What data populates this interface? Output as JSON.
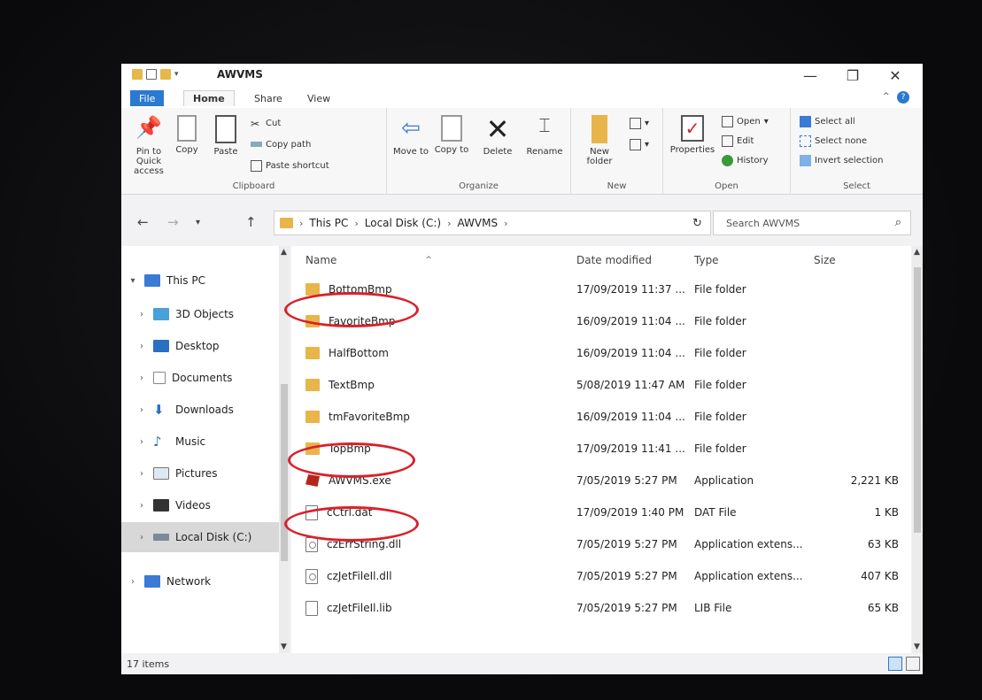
{
  "window": {
    "title": "AWVMS"
  },
  "tabs": [
    {
      "label": "File"
    },
    {
      "label": "Home"
    },
    {
      "label": "Share"
    },
    {
      "label": "View"
    }
  ],
  "ribbon": {
    "clipboard": {
      "label": "Clipboard",
      "pin": "Pin to Quick access",
      "copy": "Copy",
      "paste": "Paste",
      "cut": "Cut",
      "copy_path": "Copy path",
      "paste_shortcut": "Paste shortcut"
    },
    "organize": {
      "label": "Organize",
      "move_to": "Move to",
      "copy_to": "Copy to",
      "delete": "Delete",
      "rename": "Rename"
    },
    "new": {
      "label": "New",
      "new_folder": "New folder"
    },
    "open": {
      "label": "Open",
      "properties": "Properties",
      "open": "Open",
      "edit": "Edit",
      "history": "History"
    },
    "select": {
      "label": "Select",
      "select_all": "Select all",
      "select_none": "Select none",
      "invert": "Invert selection"
    }
  },
  "address": {
    "crumbs": [
      "This PC",
      "Local Disk (C:)",
      "AWVMS"
    ],
    "search_placeholder": "Search AWVMS"
  },
  "nav": [
    {
      "label": "This PC"
    },
    {
      "label": "3D Objects"
    },
    {
      "label": "Desktop"
    },
    {
      "label": "Documents"
    },
    {
      "label": "Downloads"
    },
    {
      "label": "Music"
    },
    {
      "label": "Pictures"
    },
    {
      "label": "Videos"
    },
    {
      "label": "Local Disk (C:)"
    },
    {
      "label": "Network"
    }
  ],
  "columns": {
    "name": "Name",
    "date": "Date modified",
    "type": "Type",
    "size": "Size"
  },
  "files": [
    {
      "name": "BottomBmp",
      "date": "17/09/2019 11:37 ...",
      "type": "File folder",
      "size": ""
    },
    {
      "name": "FavoriteBmp",
      "date": "16/09/2019 11:04 ...",
      "type": "File folder",
      "size": ""
    },
    {
      "name": "HalfBottom",
      "date": "16/09/2019 11:04 ...",
      "type": "File folder",
      "size": ""
    },
    {
      "name": "TextBmp",
      "date": "5/08/2019 11:47 AM",
      "type": "File folder",
      "size": ""
    },
    {
      "name": "tmFavoriteBmp",
      "date": "16/09/2019 11:04 ...",
      "type": "File folder",
      "size": ""
    },
    {
      "name": "TopBmp",
      "date": "17/09/2019 11:41 ...",
      "type": "File folder",
      "size": ""
    },
    {
      "name": "AWVMS.exe",
      "date": "7/05/2019 5:27 PM",
      "type": "Application",
      "size": "2,221 KB"
    },
    {
      "name": "cCtrl.dat",
      "date": "17/09/2019 1:40 PM",
      "type": "DAT File",
      "size": "1 KB"
    },
    {
      "name": "czErrString.dll",
      "date": "7/05/2019 5:27 PM",
      "type": "Application extens...",
      "size": "63 KB"
    },
    {
      "name": "czJetFileIl.dll",
      "date": "7/05/2019 5:27 PM",
      "type": "Application extens...",
      "size": "407 KB"
    },
    {
      "name": "czJetFileIl.lib",
      "date": "7/05/2019 5:27 PM",
      "type": "LIB File",
      "size": "65 KB"
    }
  ],
  "status": {
    "item_count": "17 items"
  },
  "colors": {
    "accent": "#2b79d0",
    "folder": "#e8b54a",
    "annotation": "#d8212b"
  }
}
